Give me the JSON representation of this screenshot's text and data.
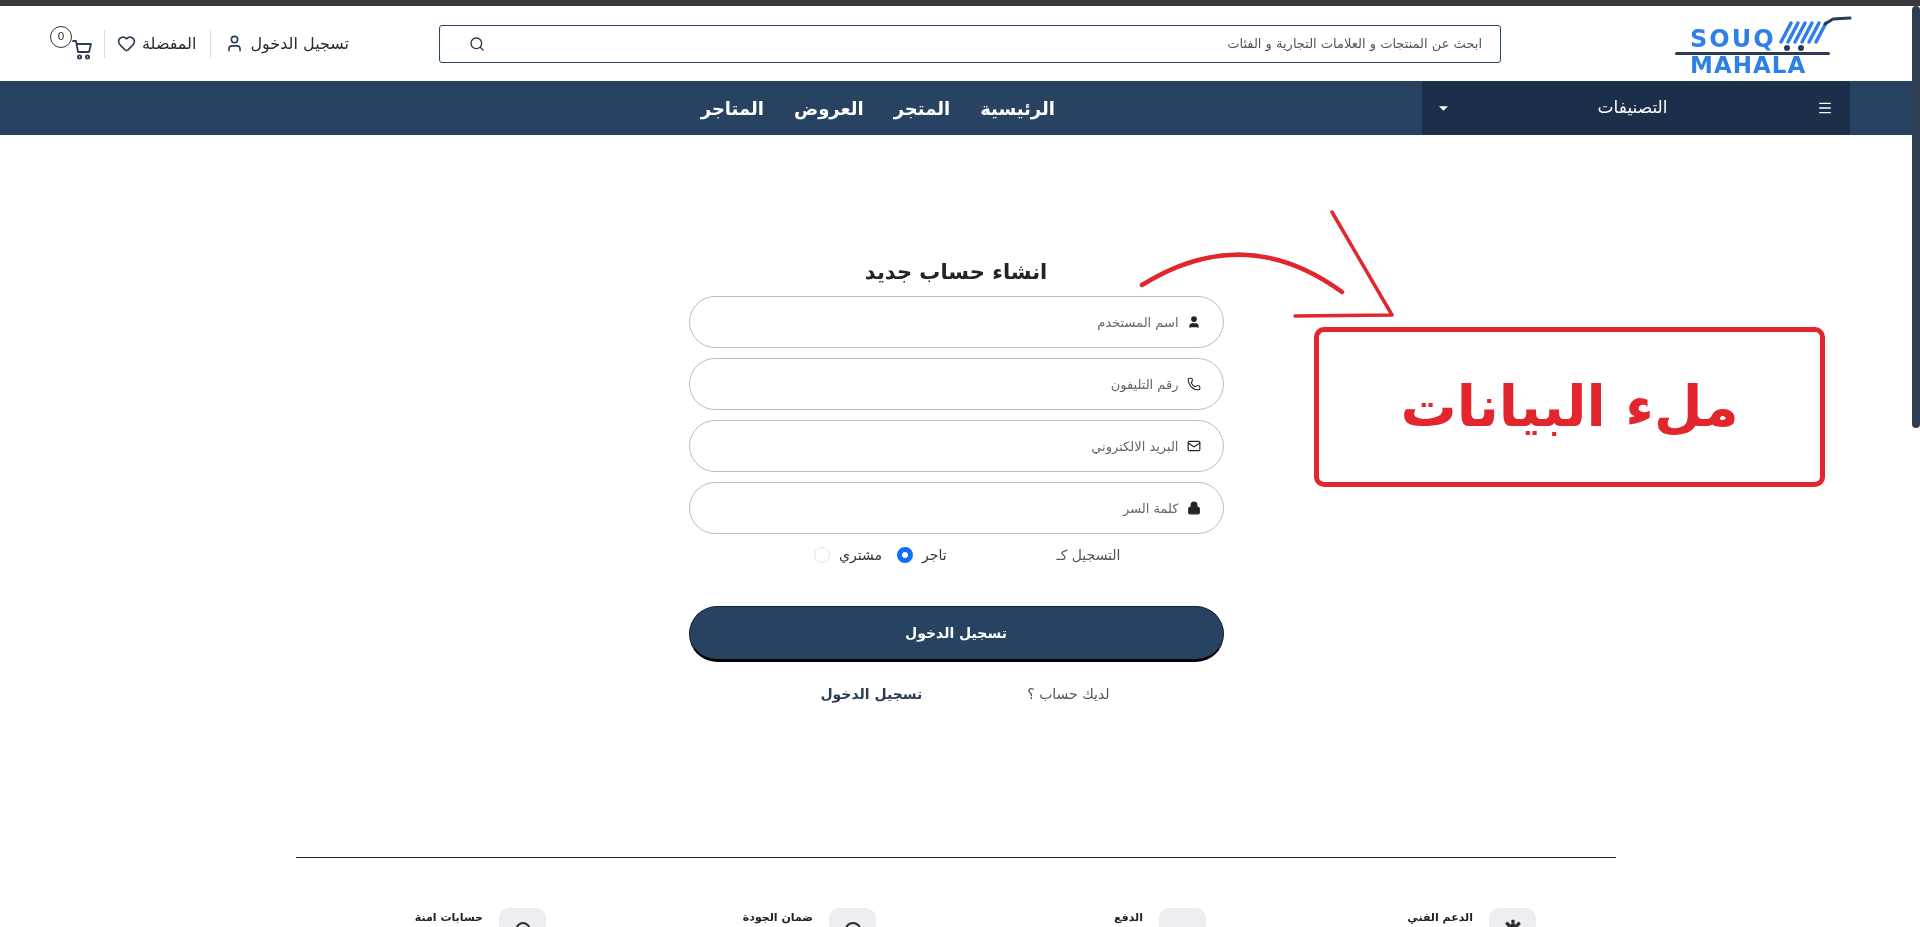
{
  "header": {
    "logo": {
      "line_1": "SOUQ",
      "line_2": "MAHALA"
    },
    "search": {
      "placeholder": "ابحث عن المنتجات و العلامات التجارية و الفئات"
    },
    "login": "تسجيل الدخول",
    "favorites": "المفضلة",
    "cart": {
      "count": "0"
    }
  },
  "nav": {
    "categories": "التصنيفات",
    "links": [
      "الرئيسية",
      "المتجر",
      "العروض",
      "المتاجر"
    ]
  },
  "form": {
    "title": "انشاء حساب جديد",
    "fields": [
      {
        "kind": "username",
        "placeholder": "اسم المستخدم"
      },
      {
        "kind": "phone",
        "placeholder": "رقم التليفون"
      },
      {
        "kind": "email",
        "placeholder": "البريد الالكتروني"
      },
      {
        "kind": "password",
        "placeholder": "كلمة السر"
      }
    ],
    "register_as": {
      "label": "التسجيل كـ",
      "options": [
        {
          "label": "تاجر",
          "selected": true
        },
        {
          "label": "مشتري",
          "selected": false
        }
      ]
    },
    "submit": "تسجيل الدخول",
    "account_prompt": {
      "text": "لديك حساب ؟",
      "link": "تسجيل الدخول"
    }
  },
  "features": [
    {
      "kind": "support",
      "label": "الدعم الفني"
    },
    {
      "kind": "payment",
      "label": "الدفع"
    },
    {
      "kind": "quality",
      "label": "ضمان الجودة"
    },
    {
      "kind": "secure",
      "label": "حسابات امنة"
    }
  ],
  "annotation": {
    "text": "ملء البيانات"
  }
}
